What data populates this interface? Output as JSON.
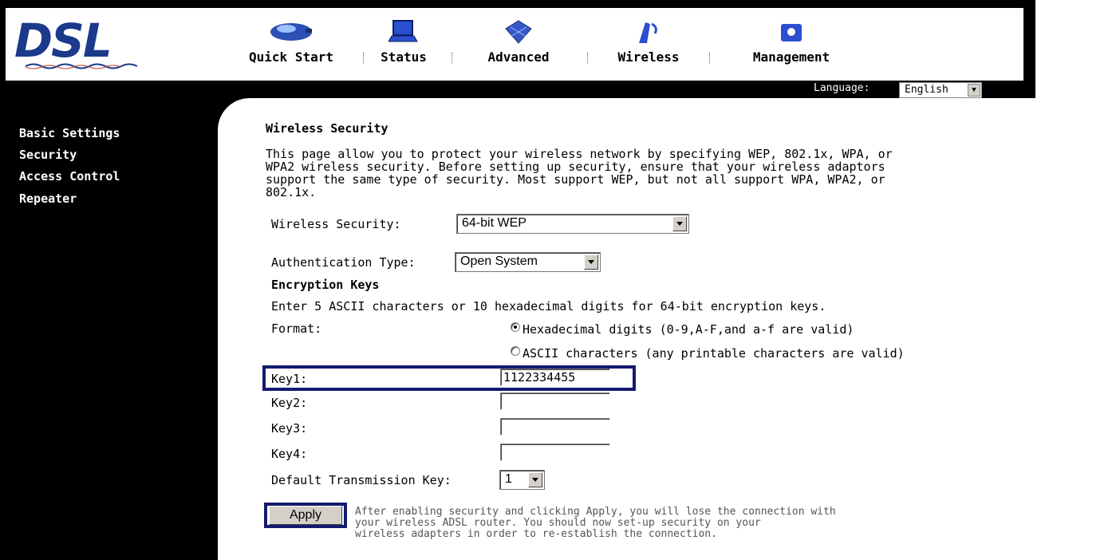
{
  "brand": {
    "logo_text": "DSL"
  },
  "nav": {
    "items": [
      {
        "label": "Quick Start",
        "icon": "car-icon"
      },
      {
        "label": "Status",
        "icon": "laptop-icon"
      },
      {
        "label": "Advanced",
        "icon": "chip-icon"
      },
      {
        "label": "Wireless",
        "icon": "antenna-icon"
      },
      {
        "label": "Management",
        "icon": "manager-icon"
      }
    ]
  },
  "language": {
    "label": "Language:",
    "value": "English"
  },
  "sidebar": {
    "items": [
      {
        "label": "Basic Settings"
      },
      {
        "label": "Security"
      },
      {
        "label": "Access Control"
      },
      {
        "label": "Repeater"
      }
    ]
  },
  "page": {
    "title": "Wireless Security",
    "description_lines": [
      "This page allow you to protect your wireless network by specifying WEP, 802.1x, WPA, or",
      "WPA2 wireless security. Before setting up security, ensure that your wireless adaptors",
      "support the same type of security. Most support WEP, but not all support WPA, WPA2, or",
      "802.1x."
    ]
  },
  "form": {
    "security_label": "Wireless Security:",
    "security_value": "64-bit WEP",
    "auth_label": "Authentication Type:",
    "auth_value": "Open System",
    "enc_heading": "Encryption Keys",
    "enc_hint": "Enter 5 ASCII characters or 10 hexadecimal digits for 64-bit encryption keys.",
    "format_label": "Format:",
    "format_hex": "Hexadecimal digits (0-9,A-F,and a-f are valid)",
    "format_ascii": "ASCII characters (any printable characters are valid)",
    "key1_label": "Key1:",
    "key1_value": "1122334455",
    "key2_label": "Key2:",
    "key2_value": "",
    "key3_label": "Key3:",
    "key3_value": "",
    "key4_label": "Key4:",
    "key4_value": "",
    "default_key_label": "Default Transmission Key:",
    "default_key_value": "1",
    "apply_label": "Apply",
    "apply_note_lines": [
      "After enabling security and clicking Apply, you will lose the connection with",
      "your wireless ADSL router. You should now set-up security on your",
      "wireless adapters in order to re-establish the connection."
    ]
  },
  "colors": {
    "logo": "#1b3a8c",
    "highlight_box": "#141a6e",
    "sidebar_bg": "#000000"
  }
}
